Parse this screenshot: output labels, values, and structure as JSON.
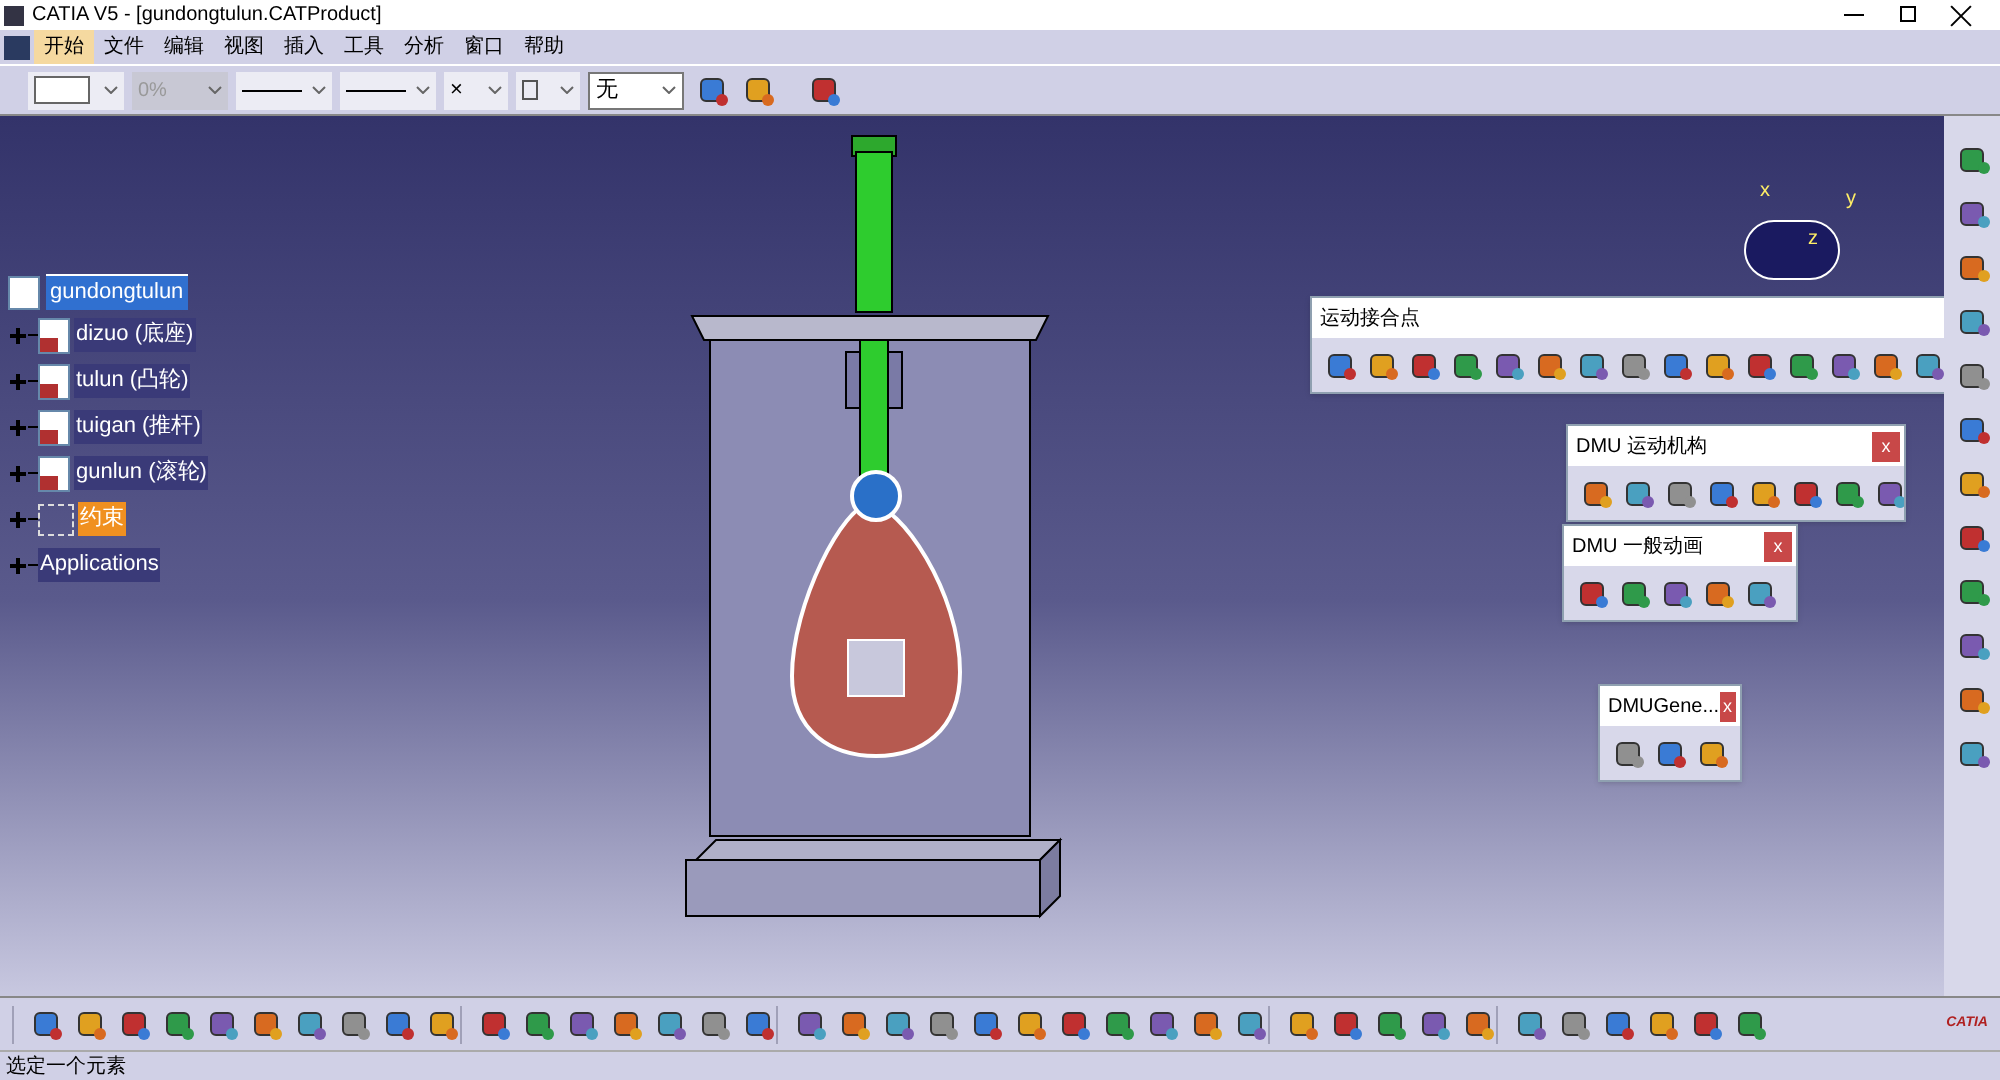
{
  "window": {
    "title": "CATIA V5 - [gundongtulun.CATProduct]"
  },
  "menu": [
    {
      "label": "开始",
      "selected": true
    },
    {
      "label": "文件",
      "selected": false
    },
    {
      "label": "编辑",
      "selected": false
    },
    {
      "label": "视图",
      "selected": false
    },
    {
      "label": "插入",
      "selected": false
    },
    {
      "label": "工具",
      "selected": false
    },
    {
      "label": "分析",
      "selected": false
    },
    {
      "label": "窗口",
      "selected": false
    },
    {
      "label": "帮助",
      "selected": false
    }
  ],
  "properties_toolbar": [
    {
      "kind": "color",
      "disabled": false
    },
    {
      "kind": "text",
      "value": "0%",
      "disabled": true
    },
    {
      "kind": "line",
      "disabled": false
    },
    {
      "kind": "line",
      "disabled": false
    },
    {
      "kind": "text",
      "value": "×",
      "disabled": false
    },
    {
      "kind": "layer",
      "disabled": false
    },
    {
      "kind": "wide",
      "value": "无",
      "disabled": false
    }
  ],
  "tree": {
    "label": "gundongtulun",
    "selected": true,
    "children": [
      {
        "label": "dizuo (底座)",
        "kind": "part",
        "expanded": false,
        "highlighted": false
      },
      {
        "label": "tulun (凸轮)",
        "kind": "part",
        "expanded": false,
        "highlighted": false
      },
      {
        "label": "tuigan (推杆)",
        "kind": "part",
        "expanded": false,
        "highlighted": false
      },
      {
        "label": "gunlun (滚轮)",
        "kind": "part",
        "expanded": false,
        "highlighted": false
      },
      {
        "label": "约束",
        "kind": "constraints",
        "expanded": false,
        "highlighted": true
      },
      {
        "label": "Applications",
        "kind": "plain",
        "expanded": false,
        "highlighted": false
      }
    ]
  },
  "compass": {
    "labels": [
      "x",
      "y",
      "z"
    ]
  },
  "floating_toolbars": [
    {
      "title": "运动接合点"
    },
    {
      "title": "DMU 运动机构",
      "close": "x"
    },
    {
      "title": "DMU 一般动画",
      "close": "x"
    },
    {
      "title": "DMUGene...",
      "close": "x"
    }
  ],
  "logo": {
    "text": "CATIA"
  },
  "status_bar": {
    "text": "选定一个元素"
  }
}
